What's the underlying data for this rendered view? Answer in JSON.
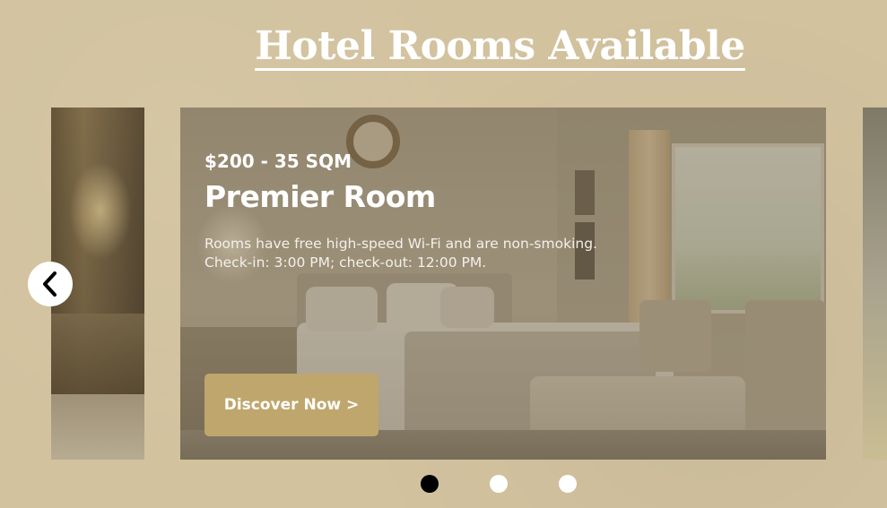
{
  "page": {
    "title": "Hotel Rooms Available"
  },
  "carousel": {
    "active_index": 0,
    "slide_count": 3,
    "current_slide": {
      "price_size": "$200 - 35 SQM",
      "room_name": "Premier Room",
      "description_lines": [
        "Rooms have free high-speed Wi-Fi and are non-smoking.",
        "Check-in: 3:00 PM; check-out: 12:00 PM."
      ],
      "cta_label": "Discover Now >"
    },
    "prev_icon": "chevron-left-icon"
  },
  "colors": {
    "background": "#d2c29e",
    "cta": "#bfa66c",
    "dot_active": "#000000",
    "dot_inactive": "#ffffff",
    "text": "#ffffff"
  }
}
